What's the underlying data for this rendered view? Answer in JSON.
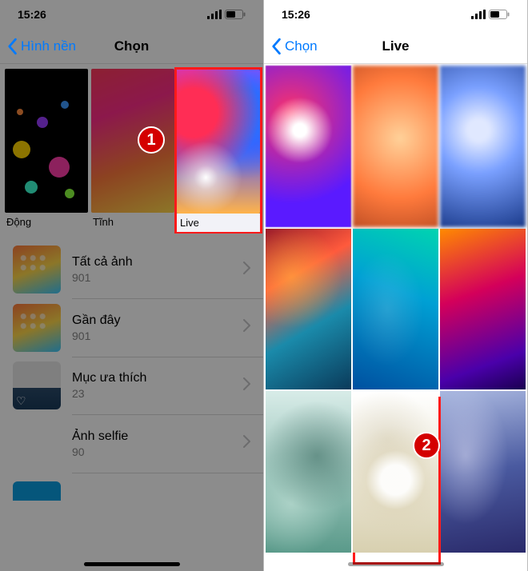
{
  "left": {
    "status": {
      "time": "15:26"
    },
    "nav": {
      "back": "Hình nền",
      "title": "Chọn"
    },
    "categories": [
      {
        "label": "Động"
      },
      {
        "label": "Tĩnh"
      },
      {
        "label": "Live"
      }
    ],
    "step_badge": "1",
    "albums": [
      {
        "title": "Tất cả ảnh",
        "count": "901"
      },
      {
        "title": "Gần đây",
        "count": "901"
      },
      {
        "title": "Mục ưa thích",
        "count": "23"
      },
      {
        "title": "Ảnh selfie",
        "count": "90"
      }
    ]
  },
  "right": {
    "status": {
      "time": "15:26"
    },
    "nav": {
      "back": "Chọn",
      "title": "Live"
    },
    "step_badge": "2"
  }
}
